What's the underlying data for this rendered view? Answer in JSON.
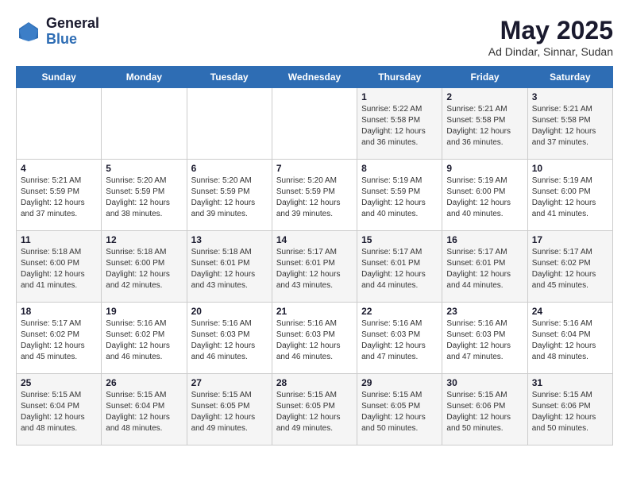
{
  "logo": {
    "general": "General",
    "blue": "Blue"
  },
  "title": "May 2025",
  "subtitle": "Ad Dindar, Sinnar, Sudan",
  "weekdays": [
    "Sunday",
    "Monday",
    "Tuesday",
    "Wednesday",
    "Thursday",
    "Friday",
    "Saturday"
  ],
  "weeks": [
    [
      {
        "day": "",
        "info": ""
      },
      {
        "day": "",
        "info": ""
      },
      {
        "day": "",
        "info": ""
      },
      {
        "day": "",
        "info": ""
      },
      {
        "day": "1",
        "info": "Sunrise: 5:22 AM\nSunset: 5:58 PM\nDaylight: 12 hours\nand 36 minutes."
      },
      {
        "day": "2",
        "info": "Sunrise: 5:21 AM\nSunset: 5:58 PM\nDaylight: 12 hours\nand 36 minutes."
      },
      {
        "day": "3",
        "info": "Sunrise: 5:21 AM\nSunset: 5:58 PM\nDaylight: 12 hours\nand 37 minutes."
      }
    ],
    [
      {
        "day": "4",
        "info": "Sunrise: 5:21 AM\nSunset: 5:59 PM\nDaylight: 12 hours\nand 37 minutes."
      },
      {
        "day": "5",
        "info": "Sunrise: 5:20 AM\nSunset: 5:59 PM\nDaylight: 12 hours\nand 38 minutes."
      },
      {
        "day": "6",
        "info": "Sunrise: 5:20 AM\nSunset: 5:59 PM\nDaylight: 12 hours\nand 39 minutes."
      },
      {
        "day": "7",
        "info": "Sunrise: 5:20 AM\nSunset: 5:59 PM\nDaylight: 12 hours\nand 39 minutes."
      },
      {
        "day": "8",
        "info": "Sunrise: 5:19 AM\nSunset: 5:59 PM\nDaylight: 12 hours\nand 40 minutes."
      },
      {
        "day": "9",
        "info": "Sunrise: 5:19 AM\nSunset: 6:00 PM\nDaylight: 12 hours\nand 40 minutes."
      },
      {
        "day": "10",
        "info": "Sunrise: 5:19 AM\nSunset: 6:00 PM\nDaylight: 12 hours\nand 41 minutes."
      }
    ],
    [
      {
        "day": "11",
        "info": "Sunrise: 5:18 AM\nSunset: 6:00 PM\nDaylight: 12 hours\nand 41 minutes."
      },
      {
        "day": "12",
        "info": "Sunrise: 5:18 AM\nSunset: 6:00 PM\nDaylight: 12 hours\nand 42 minutes."
      },
      {
        "day": "13",
        "info": "Sunrise: 5:18 AM\nSunset: 6:01 PM\nDaylight: 12 hours\nand 43 minutes."
      },
      {
        "day": "14",
        "info": "Sunrise: 5:17 AM\nSunset: 6:01 PM\nDaylight: 12 hours\nand 43 minutes."
      },
      {
        "day": "15",
        "info": "Sunrise: 5:17 AM\nSunset: 6:01 PM\nDaylight: 12 hours\nand 44 minutes."
      },
      {
        "day": "16",
        "info": "Sunrise: 5:17 AM\nSunset: 6:01 PM\nDaylight: 12 hours\nand 44 minutes."
      },
      {
        "day": "17",
        "info": "Sunrise: 5:17 AM\nSunset: 6:02 PM\nDaylight: 12 hours\nand 45 minutes."
      }
    ],
    [
      {
        "day": "18",
        "info": "Sunrise: 5:17 AM\nSunset: 6:02 PM\nDaylight: 12 hours\nand 45 minutes."
      },
      {
        "day": "19",
        "info": "Sunrise: 5:16 AM\nSunset: 6:02 PM\nDaylight: 12 hours\nand 46 minutes."
      },
      {
        "day": "20",
        "info": "Sunrise: 5:16 AM\nSunset: 6:03 PM\nDaylight: 12 hours\nand 46 minutes."
      },
      {
        "day": "21",
        "info": "Sunrise: 5:16 AM\nSunset: 6:03 PM\nDaylight: 12 hours\nand 46 minutes."
      },
      {
        "day": "22",
        "info": "Sunrise: 5:16 AM\nSunset: 6:03 PM\nDaylight: 12 hours\nand 47 minutes."
      },
      {
        "day": "23",
        "info": "Sunrise: 5:16 AM\nSunset: 6:03 PM\nDaylight: 12 hours\nand 47 minutes."
      },
      {
        "day": "24",
        "info": "Sunrise: 5:16 AM\nSunset: 6:04 PM\nDaylight: 12 hours\nand 48 minutes."
      }
    ],
    [
      {
        "day": "25",
        "info": "Sunrise: 5:15 AM\nSunset: 6:04 PM\nDaylight: 12 hours\nand 48 minutes."
      },
      {
        "day": "26",
        "info": "Sunrise: 5:15 AM\nSunset: 6:04 PM\nDaylight: 12 hours\nand 48 minutes."
      },
      {
        "day": "27",
        "info": "Sunrise: 5:15 AM\nSunset: 6:05 PM\nDaylight: 12 hours\nand 49 minutes."
      },
      {
        "day": "28",
        "info": "Sunrise: 5:15 AM\nSunset: 6:05 PM\nDaylight: 12 hours\nand 49 minutes."
      },
      {
        "day": "29",
        "info": "Sunrise: 5:15 AM\nSunset: 6:05 PM\nDaylight: 12 hours\nand 50 minutes."
      },
      {
        "day": "30",
        "info": "Sunrise: 5:15 AM\nSunset: 6:06 PM\nDaylight: 12 hours\nand 50 minutes."
      },
      {
        "day": "31",
        "info": "Sunrise: 5:15 AM\nSunset: 6:06 PM\nDaylight: 12 hours\nand 50 minutes."
      }
    ]
  ]
}
